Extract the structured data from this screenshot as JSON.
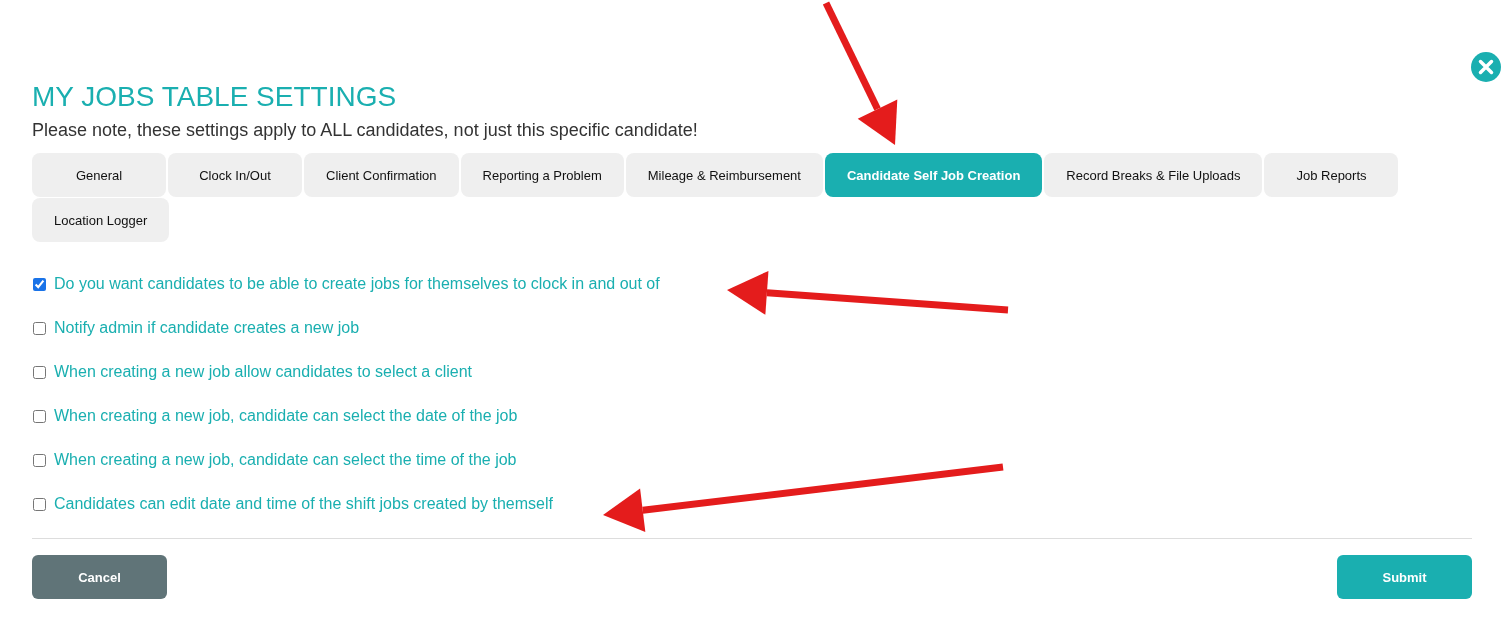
{
  "dialog": {
    "title": "MY JOBS TABLE SETTINGS",
    "note": "Please note, these settings apply to ALL candidates, not just this specific candidate!"
  },
  "tabs": [
    {
      "label": "General",
      "selected": false
    },
    {
      "label": "Clock In/Out",
      "selected": false
    },
    {
      "label": "Client Confirmation",
      "selected": false
    },
    {
      "label": "Reporting a Problem",
      "selected": false
    },
    {
      "label": "Mileage & Reimbursement",
      "selected": false
    },
    {
      "label": "Candidate Self Job Creation",
      "selected": true
    },
    {
      "label": "Record Breaks & File Uploads",
      "selected": false
    },
    {
      "label": "Job Reports",
      "selected": false
    },
    {
      "label": "Location Logger",
      "selected": false
    }
  ],
  "options": [
    {
      "label": "Do you want candidates to be able to create jobs for themselves to clock in and out of",
      "checked": true
    },
    {
      "label": "Notify admin if candidate creates a new job",
      "checked": false
    },
    {
      "label": "When creating a new job allow candidates to select a client",
      "checked": false
    },
    {
      "label": "When creating a new job, candidate can select the date of the job",
      "checked": false
    },
    {
      "label": "When creating a new job, candidate can select the time of the job",
      "checked": false
    },
    {
      "label": "Candidates can edit date and time of the shift jobs created by themself",
      "checked": false
    }
  ],
  "buttons": [
    {
      "label": "Cancel",
      "kind": "secondary"
    },
    {
      "label": "Submit",
      "kind": "primary"
    }
  ]
}
